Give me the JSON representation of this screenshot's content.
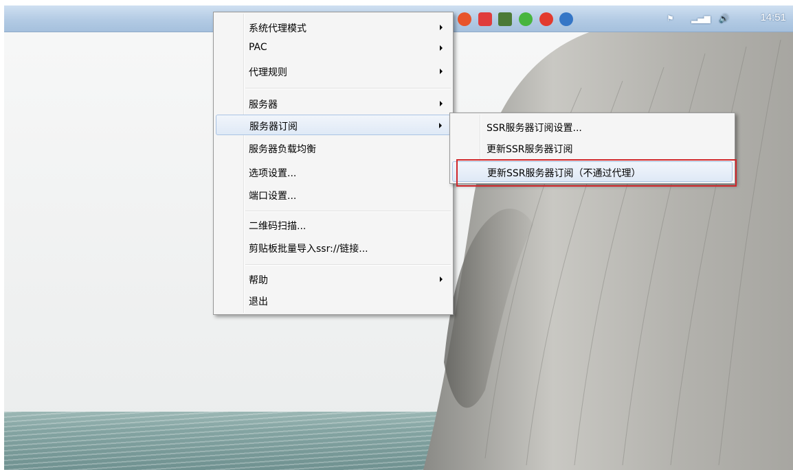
{
  "taskbar": {
    "clock": "14:51",
    "tray_icons": [
      {
        "name": "green-app-icon",
        "color": "#3cae46"
      },
      {
        "name": "blue-app-icon",
        "color": "#2d63c8"
      },
      {
        "name": "paper-plane-icon",
        "color": "#2aa86a"
      },
      {
        "name": "red-orange-app-icon",
        "color": "#e8542a"
      },
      {
        "name": "red-badge-app-icon",
        "color": "#e03c3c"
      },
      {
        "name": "eyedropper-icon",
        "color": "#4c7a36"
      },
      {
        "name": "wechat-icon",
        "color": "#48b53e"
      },
      {
        "name": "weibo-icon",
        "color": "#e23a2e"
      },
      {
        "name": "globe-icon",
        "color": "#3576c6"
      }
    ]
  },
  "main_menu": {
    "items": [
      {
        "label": "系统代理模式",
        "submenu": true
      },
      {
        "label": "PAC",
        "submenu": true
      },
      {
        "label": "代理规则",
        "submenu": true
      },
      {
        "label": "服务器",
        "submenu": true
      },
      {
        "label": "服务器订阅",
        "submenu": true,
        "highlighted": true
      },
      {
        "label": "服务器负载均衡",
        "submenu": false
      },
      {
        "label": "选项设置...",
        "submenu": false
      },
      {
        "label": "端口设置...",
        "submenu": false
      },
      {
        "label": "二维码扫描...",
        "submenu": false
      },
      {
        "label": "剪贴板批量导入ssr://链接...",
        "submenu": false
      },
      {
        "label": "帮助",
        "submenu": true
      },
      {
        "label": "退出",
        "submenu": false
      }
    ]
  },
  "sub_menu": {
    "items": [
      {
        "label": "SSR服务器订阅设置..."
      },
      {
        "label": "更新SSR服务器订阅"
      },
      {
        "label": "更新SSR服务器订阅（不通过代理）",
        "highlighted": true
      }
    ]
  },
  "colors": {
    "taskbar_top": "#cfe0f1",
    "taskbar_bottom": "#a5c0dd",
    "menu_bg": "#f5f5f5",
    "menu_highlight": "#dfe9f6",
    "annotation_red": "#d0262a"
  }
}
